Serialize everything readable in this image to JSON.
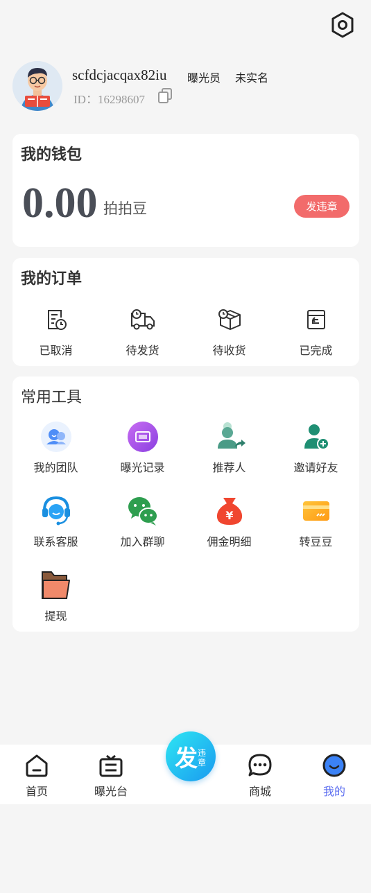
{
  "header": {
    "settings_icon": "settings-hexagon-icon"
  },
  "profile": {
    "username": "scfdcjacqax82iu",
    "role_tag": "曝光员",
    "verify_tag": "未实名",
    "id_text": "ID：16298607"
  },
  "wallet": {
    "title": "我的钱包",
    "balance": "0.00",
    "unit": "拍拍豆",
    "action_label": "发违章",
    "action_color": "#f26b6b"
  },
  "orders": {
    "title": "我的订单",
    "items": [
      {
        "label": "已取消",
        "icon": "cancelled-order-icon"
      },
      {
        "label": "待发货",
        "icon": "truck-icon"
      },
      {
        "label": "待收货",
        "icon": "package-icon"
      },
      {
        "label": "已完成",
        "icon": "completed-box-icon"
      }
    ]
  },
  "tools": {
    "title": "常用工具",
    "items": [
      {
        "label": "我的团队",
        "icon": "team-icon"
      },
      {
        "label": "曝光记录",
        "icon": "exposure-record-icon"
      },
      {
        "label": "推荐人",
        "icon": "referrer-icon"
      },
      {
        "label": "邀请好友",
        "icon": "invite-friend-icon"
      },
      {
        "label": "联系客服",
        "icon": "customer-service-icon"
      },
      {
        "label": "加入群聊",
        "icon": "wechat-group-icon"
      },
      {
        "label": "佣金明细",
        "icon": "money-bag-icon"
      },
      {
        "label": "转豆豆",
        "icon": "card-transfer-icon"
      },
      {
        "label": "提现",
        "icon": "folder-withdraw-icon"
      }
    ]
  },
  "tabbar": {
    "items": [
      {
        "label": "首页",
        "icon": "home-icon"
      },
      {
        "label": "曝光台",
        "icon": "exposure-desk-icon"
      },
      {
        "label": "商城",
        "icon": "chat-mall-icon"
      },
      {
        "label": "我的",
        "icon": "profile-smile-icon"
      }
    ],
    "center": {
      "big": "发",
      "small": "违章"
    },
    "active_color": "#5a6cf0"
  }
}
